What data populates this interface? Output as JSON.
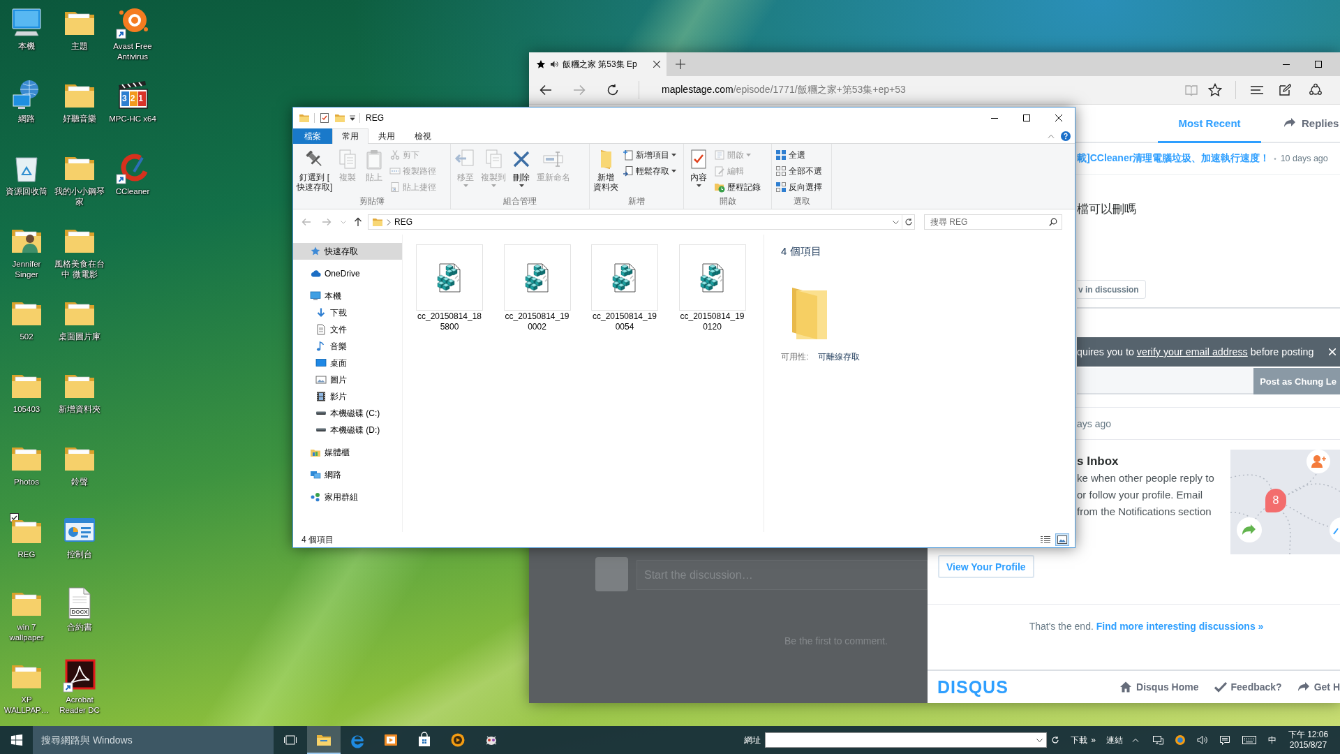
{
  "desktop": {
    "icons": [
      {
        "label": "本機",
        "kind": "computer",
        "shortcut": false,
        "selected": false
      },
      {
        "label": "網路",
        "kind": "network",
        "shortcut": false,
        "selected": false
      },
      {
        "label": "資源回收筒",
        "kind": "trash",
        "shortcut": false,
        "selected": false
      },
      {
        "label": "Jennifer\nSinger",
        "kind": "user",
        "shortcut": false,
        "selected": false
      },
      {
        "label": "502",
        "kind": "folder",
        "shortcut": false,
        "selected": false
      },
      {
        "label": "105403",
        "kind": "folder",
        "shortcut": false,
        "selected": false
      },
      {
        "label": "Photos",
        "kind": "folder",
        "shortcut": false,
        "selected": false
      },
      {
        "label": "REG",
        "kind": "folder",
        "shortcut": false,
        "selected": true
      },
      {
        "label": "win 7\nwallpaper",
        "kind": "folder",
        "shortcut": false,
        "selected": false
      },
      {
        "label": "XP\nWALLPAP…",
        "kind": "folder",
        "shortcut": false,
        "selected": false
      },
      {
        "label": "主題",
        "kind": "folder",
        "shortcut": false,
        "selected": false
      },
      {
        "label": "好聽音樂",
        "kind": "folder",
        "shortcut": false,
        "selected": false
      },
      {
        "label": "我的小小鋼琴家",
        "kind": "folder",
        "shortcut": false,
        "selected": false
      },
      {
        "label": "風格美食在台中 微電影",
        "kind": "folder",
        "shortcut": false,
        "selected": false
      },
      {
        "label": "桌面圖片庫",
        "kind": "folder",
        "shortcut": false,
        "selected": false
      },
      {
        "label": "新增資料夾",
        "kind": "folder",
        "shortcut": false,
        "selected": false
      },
      {
        "label": "鈴聲",
        "kind": "folder",
        "shortcut": false,
        "selected": false
      },
      {
        "label": "控制台",
        "kind": "panel",
        "shortcut": false,
        "selected": false
      },
      {
        "label": "合約書",
        "kind": "document",
        "tag": "DOCX",
        "shortcut": false,
        "selected": false
      },
      {
        "label": "Acrobat\nReader DC",
        "kind": "tile",
        "shortcut": true,
        "selected": false
      },
      {
        "label": "Avast Free\nAntivirus",
        "kind": "splash",
        "shortcut": true,
        "selected": false
      },
      {
        "label": "MPC-HC x64",
        "kind": "clapper",
        "tag": "321",
        "shortcut": false,
        "selected": false
      },
      {
        "label": "CCleaner",
        "kind": "ring",
        "shortcut": true,
        "selected": false
      }
    ]
  },
  "browser": {
    "tabs": [
      {
        "title": "飯糰之家 第53集 Ep",
        "selected": true,
        "audio": true
      }
    ],
    "url": {
      "host": "maplestage.com",
      "path": "/episode/1771/飯糰之家+第53集+ep+53"
    },
    "page": {
      "composer": {
        "placeholder": "Start the discussion…",
        "note": "Be the first to comment."
      }
    },
    "disqus": {
      "tabs": [
        {
          "label": "Most Recent",
          "selected": true
        },
        {
          "label": "Replies",
          "selected": false
        }
      ],
      "thread": {
        "title": "載]CCleaner清理電腦垃圾、加速執行速度！",
        "separator": "•",
        "time": "10 days ago",
        "body": "檔可以刪嗎",
        "action": "v in discussion"
      },
      "notice": {
        "before": "quires you to ",
        "link": "verify your email address",
        "after": " before posting"
      },
      "composer": {
        "button": "Post as Chung Le"
      },
      "activity": {
        "time": "ays ago"
      },
      "inbox": {
        "title": "s Inbox",
        "text": "ke when other people reply to\nor follow your profile. Email\nfrom the Notifications section",
        "badge": "8",
        "button": "View Your Profile"
      },
      "end": {
        "text": "That's the end.",
        "link": "Find more interesting discussions »"
      },
      "footer": {
        "logo": "DISQUS",
        "links": [
          "Disqus Home",
          "Feedback?",
          "Get H"
        ]
      }
    }
  },
  "explorer": {
    "title": "REG",
    "ribbon_tabs": [
      {
        "label": "檔案",
        "kind": "menu",
        "selected": false
      },
      {
        "label": "常用",
        "kind": "tab",
        "selected": true
      },
      {
        "label": "共用",
        "kind": "tab",
        "selected": false
      },
      {
        "label": "檢視",
        "kind": "tab",
        "selected": false
      }
    ],
    "ribbon_groups": [
      {
        "label": "剪貼簿",
        "buttons": [
          {
            "lines": [
              "釘選到 [",
              "快速存取]"
            ],
            "kind": "large",
            "disabled": false,
            "dropdown": false
          },
          {
            "lines": [
              "複製"
            ],
            "kind": "large",
            "disabled": true,
            "dropdown": false
          },
          {
            "lines": [
              "貼上"
            ],
            "kind": "large",
            "disabled": true,
            "dropdown": false
          },
          {
            "lines": [
              "剪下"
            ],
            "kind": "small",
            "disabled": true,
            "dropdown": false
          },
          {
            "lines": [
              "複製路徑"
            ],
            "kind": "small",
            "disabled": true,
            "dropdown": false
          },
          {
            "lines": [
              "貼上捷徑"
            ],
            "kind": "small",
            "disabled": true,
            "dropdown": false
          }
        ]
      },
      {
        "label": "組合管理",
        "buttons": [
          {
            "lines": [
              "移至"
            ],
            "kind": "large",
            "disabled": true,
            "dropdown": true
          },
          {
            "lines": [
              "複製到"
            ],
            "kind": "large",
            "disabled": true,
            "dropdown": true
          },
          {
            "lines": [
              "刪除"
            ],
            "kind": "large",
            "disabled": false,
            "dropdown": true
          },
          {
            "lines": [
              "重新命名"
            ],
            "kind": "large",
            "disabled": true,
            "dropdown": false
          }
        ]
      },
      {
        "label": "新增",
        "buttons": [
          {
            "lines": [
              "新增",
              "資料夾"
            ],
            "kind": "large",
            "disabled": false,
            "dropdown": false
          },
          {
            "lines": [
              "新增項目"
            ],
            "kind": "small",
            "disabled": false,
            "dropdown": true
          },
          {
            "lines": [
              "輕鬆存取"
            ],
            "kind": "small",
            "disabled": false,
            "dropdown": true
          }
        ]
      },
      {
        "label": "開啟",
        "buttons": [
          {
            "lines": [
              "內容"
            ],
            "kind": "large",
            "disabled": false,
            "dropdown": true
          },
          {
            "lines": [
              "開啟"
            ],
            "kind": "small",
            "disabled": true,
            "dropdown": true
          },
          {
            "lines": [
              "編輯"
            ],
            "kind": "small",
            "disabled": true,
            "dropdown": false
          },
          {
            "lines": [
              "歷程記錄"
            ],
            "kind": "small",
            "disabled": false,
            "dropdown": false
          }
        ]
      },
      {
        "label": "選取",
        "buttons": [
          {
            "lines": [
              "全選"
            ],
            "kind": "small",
            "disabled": false,
            "dropdown": false
          },
          {
            "lines": [
              "全部不選"
            ],
            "kind": "small",
            "disabled": false,
            "dropdown": false
          },
          {
            "lines": [
              "反向選擇"
            ],
            "kind": "small",
            "disabled": false,
            "dropdown": false
          }
        ]
      }
    ],
    "address": {
      "path": "REG",
      "search_placeholder": "搜尋 REG"
    },
    "nav": [
      {
        "label": "快速存取",
        "selected": true
      },
      {
        "label": "OneDrive",
        "selected": false
      },
      {
        "label": "本機",
        "selected": false,
        "children": [
          {
            "label": "下載",
            "selected": false
          },
          {
            "label": "文件",
            "selected": false
          },
          {
            "label": "音樂",
            "selected": false
          },
          {
            "label": "桌面",
            "selected": false
          },
          {
            "label": "圖片",
            "selected": false
          },
          {
            "label": "影片",
            "selected": false
          },
          {
            "label": "本機磁碟 (C:)",
            "selected": false
          },
          {
            "label": "本機磁碟 (D:)",
            "selected": false
          }
        ]
      },
      {
        "label": "媒體櫃",
        "selected": false
      },
      {
        "label": "網路",
        "selected": false
      },
      {
        "label": "家用群組",
        "selected": false
      }
    ],
    "files": [
      {
        "name": "cc_20150814_185800"
      },
      {
        "name": "cc_20150814_190002"
      },
      {
        "name": "cc_20150814_190054"
      },
      {
        "name": "cc_20150814_190120"
      }
    ],
    "details": {
      "title": "4 個項目",
      "field_label": "可用性:",
      "field_value": "可離線存取"
    },
    "status": {
      "text": "4 個項目",
      "views": [
        {
          "selected": false
        },
        {
          "selected": true
        }
      ]
    }
  },
  "taskbar": {
    "search_placeholder": "搜尋網路與 Windows",
    "apps": [
      {
        "selected": true
      },
      {
        "selected": false
      },
      {
        "selected": false
      },
      {
        "selected": false
      },
      {
        "selected": false
      },
      {
        "selected": false
      }
    ],
    "address_label": "網址",
    "links": [
      "下載",
      "»",
      "連結"
    ],
    "ime": "中",
    "time": "下午 12:06",
    "date": "2015/8/27"
  }
}
